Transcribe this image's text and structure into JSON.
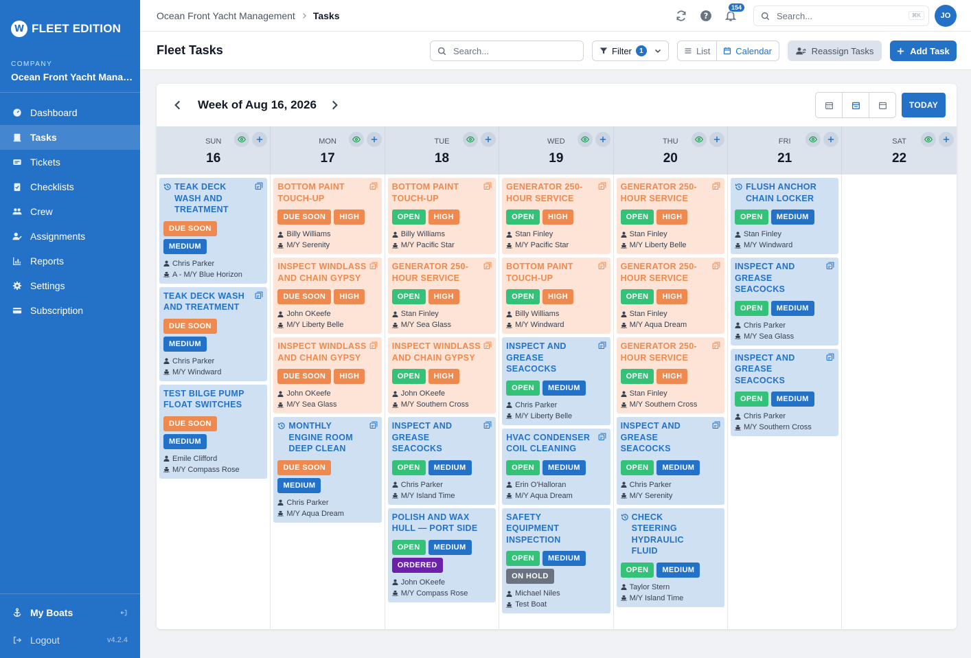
{
  "brand": {
    "logo_mark": "W",
    "name": "FLEET EDITION"
  },
  "company": {
    "label": "COMPANY",
    "name": "Ocean Front Yacht Management"
  },
  "nav": [
    {
      "label": "Dashboard",
      "icon": "dashboard-icon"
    },
    {
      "label": "Tasks",
      "icon": "tasks-icon",
      "active": true
    },
    {
      "label": "Tickets",
      "icon": "tickets-icon"
    },
    {
      "label": "Checklists",
      "icon": "checklists-icon"
    },
    {
      "label": "Crew",
      "icon": "crew-icon"
    },
    {
      "label": "Assignments",
      "icon": "assignments-icon"
    },
    {
      "label": "Reports",
      "icon": "reports-icon"
    },
    {
      "label": "Settings",
      "icon": "settings-icon"
    },
    {
      "label": "Subscription",
      "icon": "subscription-icon"
    }
  ],
  "sidebar_bottom": {
    "my_boats": "My Boats",
    "logout": "Logout",
    "version": "v4.2.4"
  },
  "topbar": {
    "breadcrumb_parent": "Ocean Front Yacht Management",
    "breadcrumb_current": "Tasks",
    "notification_count": "154",
    "search_placeholder": "Search...",
    "search_shortcut": "⌘K",
    "avatar_initials": "JO"
  },
  "header": {
    "title": "Fleet Tasks",
    "search_placeholder": "Search...",
    "filter_label": "Filter",
    "filter_count": "1",
    "view_list": "List",
    "view_calendar": "Calendar",
    "reassign_label": "Reassign Tasks",
    "add_label": "Add Task"
  },
  "calendar": {
    "week_title": "Week of Aug 16, 2026",
    "today_label": "TODAY",
    "days": [
      {
        "dow": "SUN",
        "num": "16",
        "tasks": [
          {
            "title": "TEAK DECK WASH AND TREATMENT",
            "color": "blue",
            "clock": true,
            "badges": [
              [
                "DUE SOON"
              ],
              [
                "MEDIUM"
              ]
            ],
            "assignee": "Chris Parker",
            "boat": "A - M/Y Blue Horizon"
          },
          {
            "title": "TEAK DECK WASH AND TREATMENT",
            "color": "blue",
            "badges": [
              [
                "DUE SOON"
              ],
              [
                "MEDIUM"
              ]
            ],
            "assignee": "Chris Parker",
            "boat": "M/Y Windward"
          },
          {
            "title": "TEST BILGE PUMP FLOAT SWITCHES",
            "color": "blue",
            "no_corner": true,
            "badges": [
              [
                "DUE SOON"
              ],
              [
                "MEDIUM"
              ]
            ],
            "assignee": "Emile Clifford",
            "boat": "M/Y Compass Rose"
          }
        ]
      },
      {
        "dow": "MON",
        "num": "17",
        "tasks": [
          {
            "title": "BOTTOM PAINT TOUCH-UP",
            "color": "orange",
            "badges": [
              [
                "DUE SOON",
                "HIGH"
              ]
            ],
            "assignee": "Billy Williams",
            "boat": "M/Y Serenity"
          },
          {
            "title": "INSPECT WINDLASS AND CHAIN GYPSY",
            "color": "orange",
            "badges": [
              [
                "DUE SOON",
                "HIGH"
              ]
            ],
            "assignee": "John OKeefe",
            "boat": "M/Y Liberty Belle"
          },
          {
            "title": "INSPECT WINDLASS AND CHAIN GYPSY",
            "color": "orange",
            "badges": [
              [
                "DUE SOON",
                "HIGH"
              ]
            ],
            "assignee": "John OKeefe",
            "boat": "M/Y Sea Glass"
          },
          {
            "title": "MONTHLY ENGINE ROOM DEEP CLEAN",
            "color": "blue",
            "clock": true,
            "badges": [
              [
                "DUE SOON"
              ],
              [
                "MEDIUM"
              ]
            ],
            "assignee": "Chris Parker",
            "boat": "M/Y Aqua Dream"
          }
        ]
      },
      {
        "dow": "TUE",
        "num": "18",
        "tasks": [
          {
            "title": "BOTTOM PAINT TOUCH-UP",
            "color": "orange",
            "badges": [
              [
                "OPEN",
                "HIGH"
              ]
            ],
            "assignee": "Billy Williams",
            "boat": "M/Y Pacific Star"
          },
          {
            "title": "GENERATOR 250-HOUR SERVICE",
            "color": "orange",
            "badges": [
              [
                "OPEN",
                "HIGH"
              ]
            ],
            "assignee": "Stan Finley",
            "boat": "M/Y Sea Glass"
          },
          {
            "title": "INSPECT WINDLASS AND CHAIN GYPSY",
            "color": "orange",
            "badges": [
              [
                "OPEN",
                "HIGH"
              ]
            ],
            "assignee": "John OKeefe",
            "boat": "M/Y Southern Cross"
          },
          {
            "title": "INSPECT AND GREASE SEACOCKS",
            "color": "blue",
            "badges": [
              [
                "OPEN",
                "MEDIUM"
              ]
            ],
            "assignee": "Chris Parker",
            "boat": "M/Y Island Time"
          },
          {
            "title": "POLISH AND WAX HULL — PORT SIDE",
            "color": "blue",
            "no_corner": true,
            "badges": [
              [
                "OPEN",
                "MEDIUM"
              ],
              [
                "ORDERED"
              ]
            ],
            "assignee": "John OKeefe",
            "boat": "M/Y Compass Rose"
          }
        ]
      },
      {
        "dow": "WED",
        "num": "19",
        "tasks": [
          {
            "title": "GENERATOR 250-HOUR SERVICE",
            "color": "orange",
            "badges": [
              [
                "OPEN",
                "HIGH"
              ]
            ],
            "assignee": "Stan Finley",
            "boat": "M/Y Pacific Star"
          },
          {
            "title": "BOTTOM PAINT TOUCH-UP",
            "color": "orange",
            "badges": [
              [
                "OPEN",
                "HIGH"
              ]
            ],
            "assignee": "Billy Williams",
            "boat": "M/Y Windward"
          },
          {
            "title": "INSPECT AND GREASE SEACOCKS",
            "color": "blue",
            "badges": [
              [
                "OPEN",
                "MEDIUM"
              ]
            ],
            "assignee": "Chris Parker",
            "boat": "M/Y Liberty Belle"
          },
          {
            "title": "HVAC CONDENSER COIL CLEANING",
            "color": "blue",
            "badges": [
              [
                "OPEN",
                "MEDIUM"
              ]
            ],
            "assignee": "Erin O'Halloran",
            "boat": "M/Y Aqua Dream"
          },
          {
            "title": "SAFETY EQUIPMENT INSPECTION",
            "color": "blue",
            "no_corner": true,
            "badges": [
              [
                "OPEN",
                "MEDIUM"
              ],
              [
                "ON HOLD"
              ]
            ],
            "assignee": "Michael Niles",
            "boat": "Test Boat"
          }
        ]
      },
      {
        "dow": "THU",
        "num": "20",
        "tasks": [
          {
            "title": "GENERATOR 250-HOUR SERVICE",
            "color": "orange",
            "badges": [
              [
                "OPEN",
                "HIGH"
              ]
            ],
            "assignee": "Stan Finley",
            "boat": "M/Y Liberty Belle"
          },
          {
            "title": "GENERATOR 250-HOUR SERVICE",
            "color": "orange",
            "badges": [
              [
                "OPEN",
                "HIGH"
              ]
            ],
            "assignee": "Stan Finley",
            "boat": "M/Y Aqua Dream"
          },
          {
            "title": "GENERATOR 250-HOUR SERVICE",
            "color": "orange",
            "badges": [
              [
                "OPEN",
                "HIGH"
              ]
            ],
            "assignee": "Stan Finley",
            "boat": "M/Y Southern Cross"
          },
          {
            "title": "INSPECT AND GREASE SEACOCKS",
            "color": "blue",
            "badges": [
              [
                "OPEN",
                "MEDIUM"
              ]
            ],
            "assignee": "Chris Parker",
            "boat": "M/Y Serenity"
          },
          {
            "title": "CHECK STEERING HYDRAULIC FLUID",
            "color": "blue",
            "clock": true,
            "no_corner": true,
            "badges": [
              [
                "OPEN",
                "MEDIUM"
              ]
            ],
            "assignee": "Taylor Stern",
            "boat": "M/Y Island Time"
          }
        ]
      },
      {
        "dow": "FRI",
        "num": "21",
        "tasks": [
          {
            "title": "FLUSH ANCHOR CHAIN LOCKER",
            "color": "blue",
            "clock": true,
            "no_corner": true,
            "badges": [
              [
                "OPEN",
                "MEDIUM"
              ]
            ],
            "assignee": "Stan Finley",
            "boat": "M/Y Windward"
          },
          {
            "title": "INSPECT AND GREASE SEACOCKS",
            "color": "blue",
            "badges": [
              [
                "OPEN",
                "MEDIUM"
              ]
            ],
            "assignee": "Chris Parker",
            "boat": "M/Y Sea Glass"
          },
          {
            "title": "INSPECT AND GREASE SEACOCKS",
            "color": "blue",
            "badges": [
              [
                "OPEN",
                "MEDIUM"
              ]
            ],
            "assignee": "Chris Parker",
            "boat": "M/Y Southern Cross"
          }
        ]
      },
      {
        "dow": "SAT",
        "num": "22",
        "tasks": []
      }
    ]
  },
  "colors": {
    "sidebar": "#2472c8",
    "open": "#34c178",
    "high": "#ee8a4f",
    "medium": "#2472c8",
    "ordered": "#6b21a8",
    "on_hold": "#6b7280",
    "card_blue": "#cfe0f3",
    "card_orange": "#fde4d6"
  }
}
